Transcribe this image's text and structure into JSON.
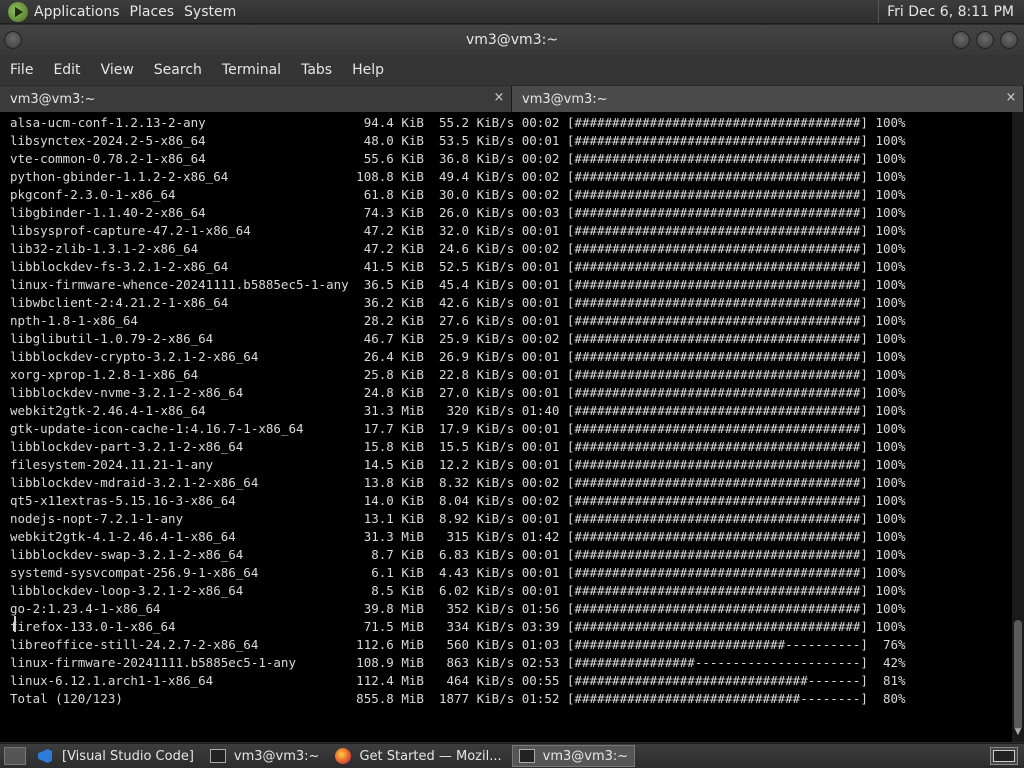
{
  "panel": {
    "applications": "Applications",
    "places": "Places",
    "system": "System",
    "clock": "Fri Dec 6,  8:11 PM"
  },
  "window": {
    "title": "vm3@vm3:~"
  },
  "menu": [
    "File",
    "Edit",
    "View",
    "Search",
    "Terminal",
    "Tabs",
    "Help"
  ],
  "tabs": [
    {
      "label": "vm3@vm3:~",
      "close": "×"
    },
    {
      "label": "vm3@vm3:~",
      "close": "×"
    }
  ],
  "terminal": {
    "lines": [
      "alsa-ucm-conf-1.2.13-2-any                     94.4 KiB  55.2 KiB/s 00:02 [######################################] 100%",
      "libsynctex-2024.2-5-x86_64                     48.0 KiB  53.5 KiB/s 00:01 [######################################] 100%",
      "vte-common-0.78.2-1-x86_64                     55.6 KiB  36.8 KiB/s 00:02 [######################################] 100%",
      "python-gbinder-1.1.2-2-x86_64                 108.8 KiB  49.4 KiB/s 00:02 [######################################] 100%",
      "pkgconf-2.3.0-1-x86_64                         61.8 KiB  30.0 KiB/s 00:02 [######################################] 100%",
      "libgbinder-1.1.40-2-x86_64                     74.3 KiB  26.0 KiB/s 00:03 [######################################] 100%",
      "libsysprof-capture-47.2-1-x86_64               47.2 KiB  32.0 KiB/s 00:01 [######################################] 100%",
      "lib32-zlib-1.3.1-2-x86_64                      47.2 KiB  24.6 KiB/s 00:02 [######################################] 100%",
      "libblockdev-fs-3.2.1-2-x86_64                  41.5 KiB  52.5 KiB/s 00:01 [######################################] 100%",
      "linux-firmware-whence-20241111.b5885ec5-1-any  36.5 KiB  45.4 KiB/s 00:01 [######################################] 100%",
      "libwbclient-2:4.21.2-1-x86_64                  36.2 KiB  42.6 KiB/s 00:01 [######################################] 100%",
      "npth-1.8-1-x86_64                              28.2 KiB  27.6 KiB/s 00:01 [######################################] 100%",
      "libglibutil-1.0.79-2-x86_64                    46.7 KiB  25.9 KiB/s 00:02 [######################################] 100%",
      "libblockdev-crypto-3.2.1-2-x86_64              26.4 KiB  26.9 KiB/s 00:01 [######################################] 100%",
      "xorg-xprop-1.2.8-1-x86_64                      25.8 KiB  22.8 KiB/s 00:01 [######################################] 100%",
      "libblockdev-nvme-3.2.1-2-x86_64                24.8 KiB  27.0 KiB/s 00:01 [######################################] 100%",
      "webkit2gtk-2.46.4-1-x86_64                     31.3 MiB   320 KiB/s 01:40 [######################################] 100%",
      "gtk-update-icon-cache-1:4.16.7-1-x86_64        17.7 KiB  17.9 KiB/s 00:01 [######################################] 100%",
      "libblockdev-part-3.2.1-2-x86_64                15.8 KiB  15.5 KiB/s 00:01 [######################################] 100%",
      "filesystem-2024.11.21-1-any                    14.5 KiB  12.2 KiB/s 00:01 [######################################] 100%",
      "libblockdev-mdraid-3.2.1-2-x86_64              13.8 KiB  8.32 KiB/s 00:02 [######################################] 100%",
      "qt5-x11extras-5.15.16-3-x86_64                 14.0 KiB  8.04 KiB/s 00:02 [######################################] 100%",
      "nodejs-nopt-7.2.1-1-any                        13.1 KiB  8.92 KiB/s 00:01 [######################################] 100%",
      "webkit2gtk-4.1-2.46.4-1-x86_64                 31.3 MiB   315 KiB/s 01:42 [######################################] 100%",
      "libblockdev-swap-3.2.1-2-x86_64                 8.7 KiB  6.83 KiB/s 00:01 [######################################] 100%",
      "systemd-sysvcompat-256.9-1-x86_64               6.1 KiB  4.43 KiB/s 00:01 [######################################] 100%",
      "libblockdev-loop-3.2.1-2-x86_64                 8.5 KiB  6.02 KiB/s 00:01 [######################################] 100%",
      "go-2:1.23.4-1-x86_64                           39.8 MiB   352 KiB/s 01:56 [######################################] 100%",
      "firefox-133.0-1-x86_64                         71.5 MiB   334 KiB/s 03:39 [######################################] 100%",
      "libreoffice-still-24.2.7-2-x86_64             112.6 MiB   560 KiB/s 01:03 [############################----------]  76%",
      "linux-firmware-20241111.b5885ec5-1-any        108.9 MiB   863 KiB/s 02:53 [################----------------------]  42%",
      "linux-6.12.1.arch1-1-x86_64                   112.4 MiB   464 KiB/s 00:55 [###############################-------]  81%",
      "Total (120/123)                               855.8 MiB  1877 KiB/s 01:52 [##############################--------]  80%"
    ]
  },
  "taskbar": {
    "items": [
      {
        "label": "[Visual Studio Code]",
        "icon": "vscode-icon"
      },
      {
        "label": "vm3@vm3:~",
        "icon": "terminal-icon"
      },
      {
        "label": "Get Started — Mozil...",
        "icon": "firefox-icon"
      },
      {
        "label": "vm3@vm3:~",
        "icon": "terminal-icon"
      }
    ]
  }
}
